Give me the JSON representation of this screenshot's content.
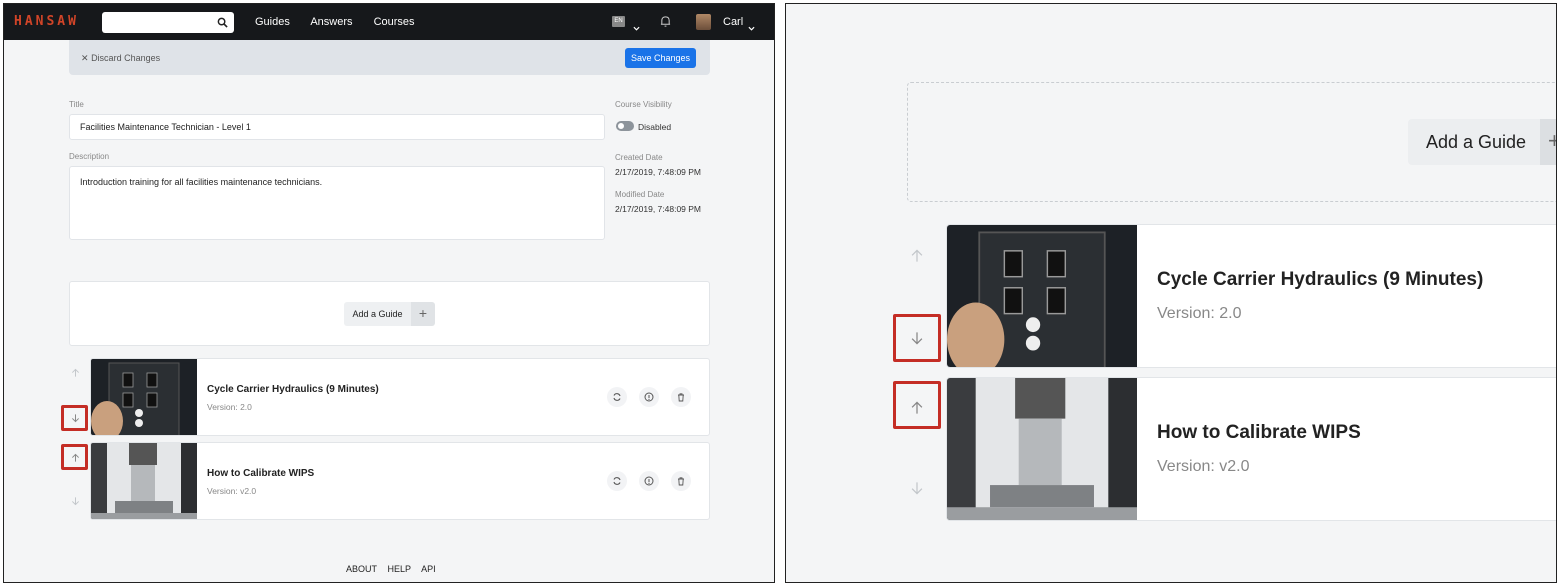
{
  "nav": {
    "brand": "HANSAW",
    "links": [
      "Guides",
      "Answers",
      "Courses"
    ],
    "lang": "EN",
    "user": "Carl"
  },
  "edit_bar": {
    "discard_label": "Discard Changes",
    "save_label": "Save Changes"
  },
  "form": {
    "title_label": "Title",
    "title_value": "Facilities Maintenance Technician - Level 1",
    "description_label": "Description",
    "description_value": "Introduction training for all facilities maintenance technicians.",
    "visibility_label": "Course Visibility",
    "visibility_value": "Disabled",
    "created_label": "Created Date",
    "created_value": "2/17/2019, 7:48:09 PM",
    "modified_label": "Modified Date",
    "modified_value": "2/17/2019, 7:48:09 PM"
  },
  "add_guide": {
    "label": "Add a Guide",
    "plus": "+"
  },
  "guides": [
    {
      "title": "Cycle Carrier Hydraulics (9 Minutes)",
      "version": "Version: 2.0"
    },
    {
      "title": "How to Calibrate WIPS",
      "version": "Version: v2.0"
    }
  ],
  "footer": [
    "ABOUT",
    "HELP",
    "API"
  ],
  "colors": {
    "nav_bg": "#16181b",
    "brand": "#d04428",
    "primary": "#1a73e8",
    "highlight": "#c42d25"
  },
  "icons": [
    "search-icon",
    "bell-icon",
    "chevron-down-icon",
    "close-icon",
    "plus-icon",
    "arrow-up-icon",
    "arrow-down-icon",
    "sync-icon",
    "info-icon",
    "trash-icon"
  ]
}
